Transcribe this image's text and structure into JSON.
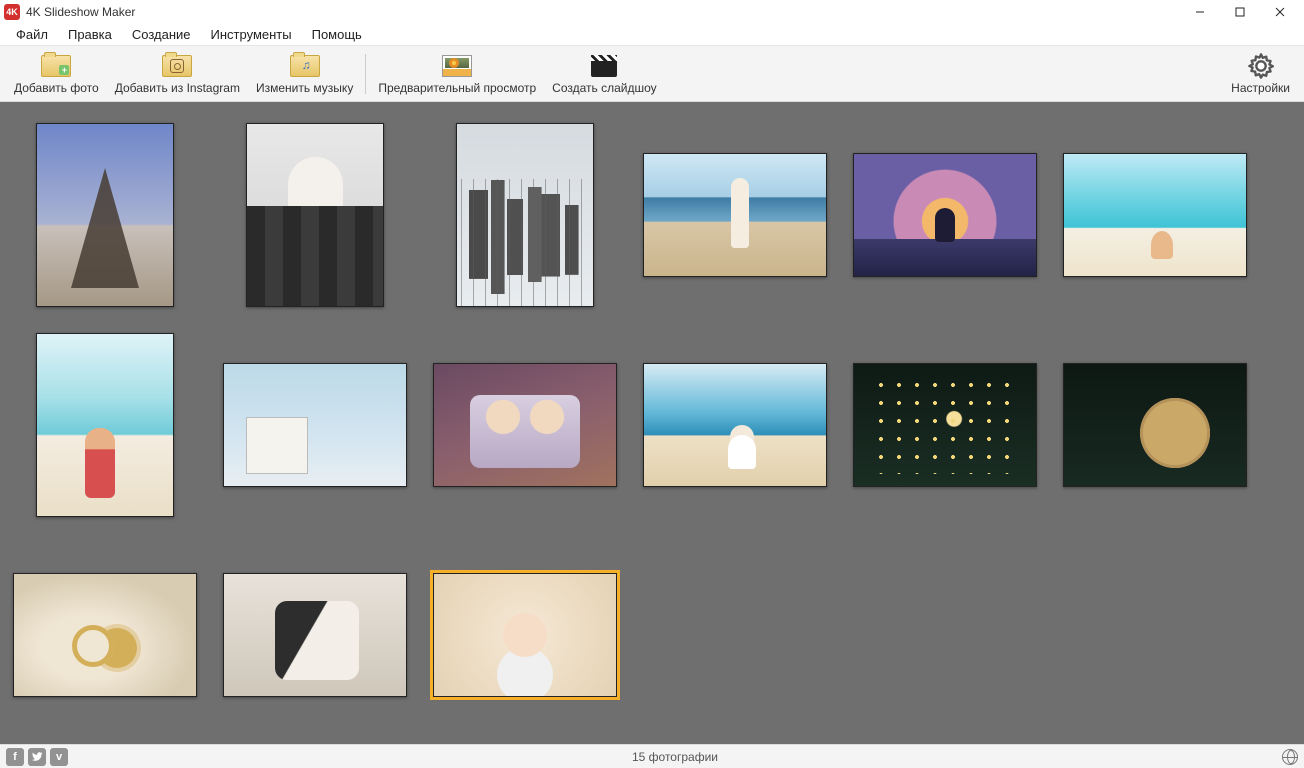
{
  "title": "4K Slideshow Maker",
  "menu": {
    "file": "Файл",
    "edit": "Правка",
    "create": "Создание",
    "tools": "Инструменты",
    "help": "Помощь"
  },
  "toolbar": {
    "add_photo": "Добавить фото",
    "add_instagram": "Добавить из Instagram",
    "change_music": "Изменить музыку",
    "preview": "Предварительный просмотр",
    "make_slideshow": "Создать слайдшоу",
    "settings": "Настройки"
  },
  "thumbs": [
    {
      "name": "photo-eiffel",
      "orient": "portrait",
      "scene": "sc-eiffel",
      "selected": false
    },
    {
      "name": "photo-woman-balcony",
      "orient": "portrait",
      "scene": "sc-woman-balcony",
      "selected": false
    },
    {
      "name": "photo-skyline",
      "orient": "portrait",
      "scene": "sc-skyline",
      "selected": false
    },
    {
      "name": "photo-beach-walk",
      "orient": "landscape",
      "scene": "sc-beach-walk",
      "selected": false
    },
    {
      "name": "photo-sunset-heart",
      "orient": "landscape",
      "scene": "sc-sunset",
      "selected": false
    },
    {
      "name": "photo-turquoise-beach",
      "orient": "landscape",
      "scene": "sc-turquoise",
      "selected": false
    },
    {
      "name": "photo-beach-kneel",
      "orient": "portrait",
      "scene": "sc-kneel",
      "selected": false
    },
    {
      "name": "photo-lifeguard",
      "orient": "landscape",
      "scene": "sc-lifeguard",
      "selected": false
    },
    {
      "name": "photo-family-kiss",
      "orient": "landscape",
      "scene": "sc-family",
      "selected": false
    },
    {
      "name": "photo-beach-hat",
      "orient": "landscape",
      "scene": "sc-hat",
      "selected": false
    },
    {
      "name": "photo-xmas-tree",
      "orient": "landscape",
      "scene": "sc-tree",
      "selected": false
    },
    {
      "name": "photo-merry-christmas",
      "orient": "landscape",
      "scene": "sc-merry",
      "selected": false
    },
    {
      "name": "photo-rings",
      "orient": "landscape",
      "scene": "sc-rings",
      "selected": false
    },
    {
      "name": "photo-wedding",
      "orient": "landscape",
      "scene": "sc-wedding",
      "selected": false
    },
    {
      "name": "photo-baby",
      "orient": "landscape",
      "scene": "sc-baby",
      "selected": true
    }
  ],
  "per_row": 6,
  "status": {
    "count_text": "15 фотографии"
  },
  "social": {
    "facebook": "f",
    "twitter": "t",
    "vimeo": "v"
  }
}
